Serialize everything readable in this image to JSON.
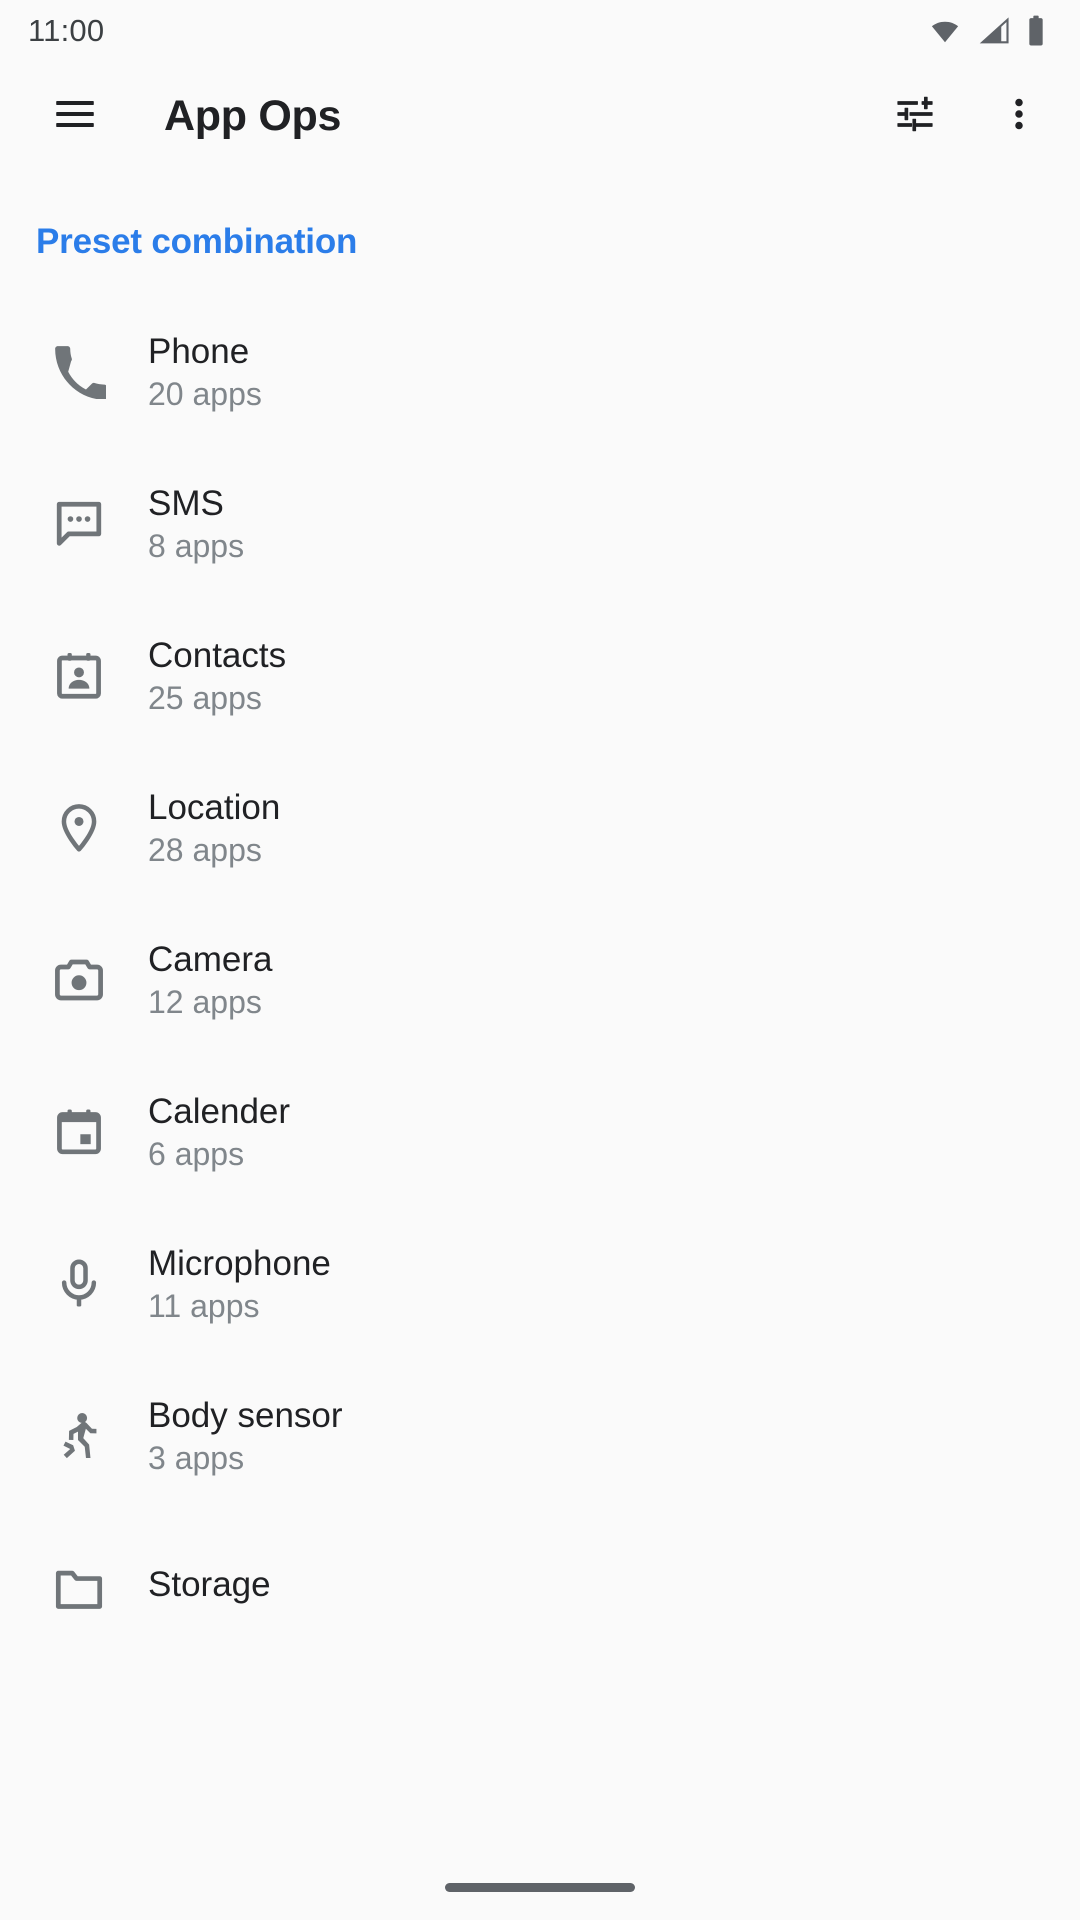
{
  "status_bar": {
    "clock": "11:00",
    "icons": [
      "wifi-icon",
      "cellular-signal-icon",
      "battery-icon"
    ]
  },
  "app_bar": {
    "menu_icon": "hamburger-menu-icon",
    "title": "App Ops",
    "actions": [
      {
        "icon": "tune-filter-icon",
        "name": "filter-button"
      },
      {
        "icon": "overflow-menu-icon",
        "name": "overflow-menu-button"
      }
    ]
  },
  "preset": {
    "label": "Preset combination",
    "color": "#2b7de9"
  },
  "list": {
    "items": [
      {
        "icon": "phone-icon",
        "title": "Phone",
        "subtitle": "20 apps"
      },
      {
        "icon": "sms-icon",
        "title": "SMS",
        "subtitle": "8 apps"
      },
      {
        "icon": "contacts-icon",
        "title": "Contacts",
        "subtitle": "25 apps"
      },
      {
        "icon": "location-pin-icon",
        "title": "Location",
        "subtitle": "28 apps"
      },
      {
        "icon": "camera-icon",
        "title": "Camera",
        "subtitle": "12 apps"
      },
      {
        "icon": "calendar-icon",
        "title": "Calender",
        "subtitle": "6 apps"
      },
      {
        "icon": "microphone-icon",
        "title": "Microphone",
        "subtitle": "11 apps"
      },
      {
        "icon": "body-sensor-icon",
        "title": "Body sensor",
        "subtitle": "3 apps"
      },
      {
        "icon": "folder-icon",
        "title": "Storage",
        "subtitle": ""
      }
    ]
  },
  "nav_bar": {
    "handle": "gesture-home-handle"
  },
  "theme": {
    "background": "#fafafa",
    "primary_text": "#202124",
    "secondary_text": "#80868b",
    "icon_gray": "#707579",
    "accent": "#2b7de9"
  }
}
